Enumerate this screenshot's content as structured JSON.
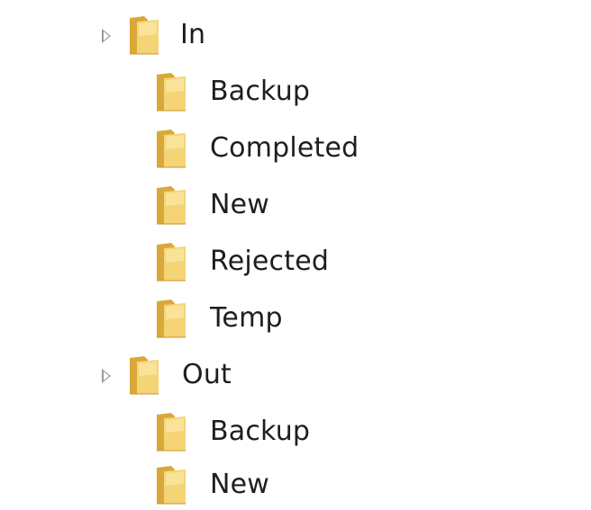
{
  "tree": {
    "nodes": [
      {
        "label": "In",
        "level": 0,
        "expandable": true
      },
      {
        "label": "Backup",
        "level": 1,
        "expandable": false
      },
      {
        "label": "Completed",
        "level": 1,
        "expandable": false
      },
      {
        "label": "New",
        "level": 1,
        "expandable": false
      },
      {
        "label": "Rejected",
        "level": 1,
        "expandable": false
      },
      {
        "label": "Temp",
        "level": 1,
        "expandable": false
      },
      {
        "label": "Out",
        "level": 0,
        "expandable": true
      },
      {
        "label": "Backup",
        "level": 1,
        "expandable": false
      },
      {
        "label": "New",
        "level": 1,
        "expandable": false
      }
    ]
  },
  "icons": {
    "folder": "folder-icon",
    "expander": "chevron-right-icon"
  },
  "colors": {
    "folder_back": "#d9a83a",
    "folder_front": "#f5d476",
    "folder_highlight": "#fbe9a8",
    "expander": "#9a9a9a",
    "text": "#1e1e1e"
  }
}
